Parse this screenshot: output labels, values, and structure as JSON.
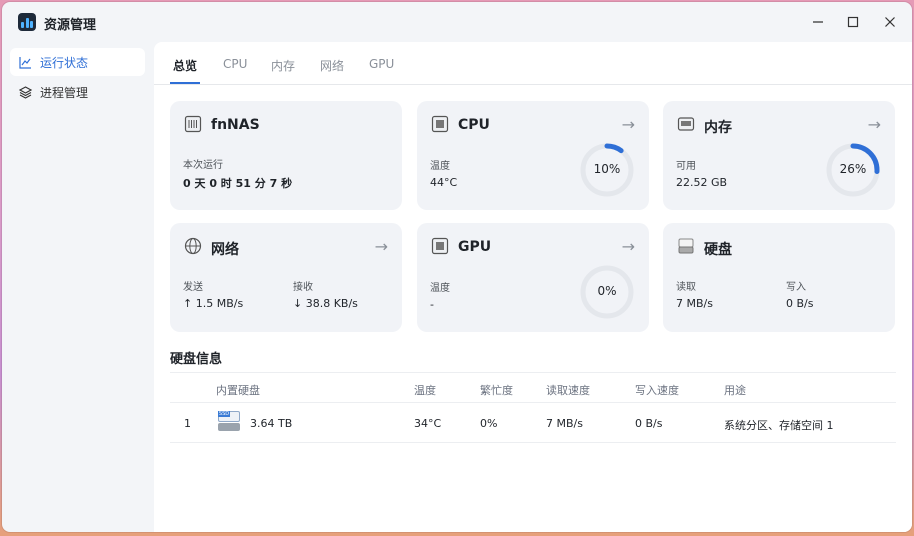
{
  "window": {
    "title": "资源管理"
  },
  "sidebar": {
    "items": [
      {
        "label": "运行状态",
        "icon": "chart-line-icon",
        "active": true
      },
      {
        "label": "进程管理",
        "icon": "layers-icon",
        "active": false
      }
    ]
  },
  "tabs": [
    {
      "label": "总览",
      "active": true
    },
    {
      "label": "CPU",
      "active": false
    },
    {
      "label": "内存",
      "active": false
    },
    {
      "label": "网络",
      "active": false
    },
    {
      "label": "GPU",
      "active": false
    }
  ],
  "cards": {
    "system": {
      "title": "fnNAS",
      "uptime_label": "本次运行",
      "uptime_value": "0 天 0 时 51 分 7 秒"
    },
    "cpu": {
      "title": "CPU",
      "temp_label": "温度",
      "temp_value": "44°C",
      "usage_text": "10%",
      "usage": 0.1
    },
    "memory": {
      "title": "内存",
      "avail_label": "可用",
      "avail_value": "22.52 GB",
      "usage_text": "26%",
      "usage": 0.26
    },
    "network": {
      "title": "网络",
      "send_label": "发送",
      "send_value": "↑ 1.5 MB/s",
      "recv_label": "接收",
      "recv_value": "↓ 38.8 KB/s"
    },
    "gpu": {
      "title": "GPU",
      "temp_label": "温度",
      "temp_value": "-",
      "usage_text": "0%",
      "usage": 0
    },
    "disk": {
      "title": "硬盘",
      "read_label": "读取",
      "read_value": "7 MB/s",
      "write_label": "写入",
      "write_value": "0 B/s"
    }
  },
  "disk_info": {
    "title": "硬盘信息",
    "headers": [
      "内置硬盘",
      "温度",
      "繁忙度",
      "读取速度",
      "写入速度",
      "用途"
    ],
    "rows": [
      {
        "index": "1",
        "drive_badge": "SSD",
        "capacity": "3.64 TB",
        "temp": "34°C",
        "busy": "0%",
        "read": "7 MB/s",
        "write": "0 B/s",
        "usage": "系统分区、存储空间 1"
      }
    ]
  },
  "colors": {
    "accent": "#2f6fd6",
    "ring_track": "#e4e7ec"
  }
}
